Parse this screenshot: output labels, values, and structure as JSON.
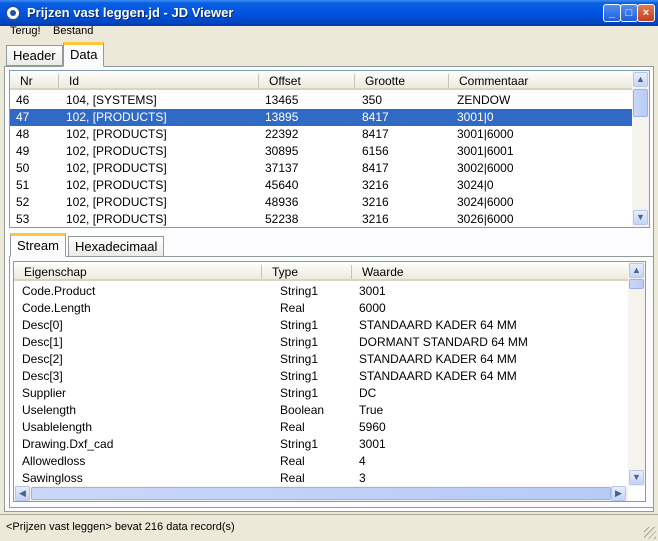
{
  "window": {
    "title": "Prijzen vast leggen.jd - JD Viewer"
  },
  "menu": {
    "back": "Terug!",
    "file": "Bestand"
  },
  "top_tabs": [
    {
      "label": "Header"
    },
    {
      "label": "Data"
    }
  ],
  "records": {
    "columns": [
      "Nr",
      "Id",
      "Offset",
      "Grootte",
      "Commentaar"
    ],
    "rows": [
      {
        "nr": "46",
        "id": "104, [SYSTEMS]",
        "offset": "13465",
        "size": "350",
        "comment": "ZENDOW"
      },
      {
        "nr": "47",
        "id": "102, [PRODUCTS]",
        "offset": "13895",
        "size": "8417",
        "comment": "3001|0"
      },
      {
        "nr": "48",
        "id": "102, [PRODUCTS]",
        "offset": "22392",
        "size": "8417",
        "comment": "3001|6000"
      },
      {
        "nr": "49",
        "id": "102, [PRODUCTS]",
        "offset": "30895",
        "size": "6156",
        "comment": "3001|6001"
      },
      {
        "nr": "50",
        "id": "102, [PRODUCTS]",
        "offset": "37137",
        "size": "8417",
        "comment": "3002|6000"
      },
      {
        "nr": "51",
        "id": "102, [PRODUCTS]",
        "offset": "45640",
        "size": "3216",
        "comment": "3024|0"
      },
      {
        "nr": "52",
        "id": "102, [PRODUCTS]",
        "offset": "48936",
        "size": "3216",
        "comment": "3024|6000"
      },
      {
        "nr": "53",
        "id": "102, [PRODUCTS]",
        "offset": "52238",
        "size": "3216",
        "comment": "3026|6000"
      }
    ],
    "selected_nr": "47"
  },
  "bottom_tabs": [
    {
      "label": "Stream"
    },
    {
      "label": "Hexadecimaal"
    }
  ],
  "properties": {
    "columns": [
      "Eigenschap",
      "Type",
      "Waarde"
    ],
    "rows": [
      {
        "name": "Code.Product",
        "type": "String1",
        "value": "3001"
      },
      {
        "name": "Code.Length",
        "type": "Real",
        "value": "6000"
      },
      {
        "name": "Desc[0]",
        "type": "String1",
        "value": "STANDAARD KADER 64 MM"
      },
      {
        "name": "Desc[1]",
        "type": "String1",
        "value": "DORMANT STANDARD 64 MM"
      },
      {
        "name": "Desc[2]",
        "type": "String1",
        "value": "STANDAARD KADER 64 MM"
      },
      {
        "name": "Desc[3]",
        "type": "String1",
        "value": "STANDAARD KADER 64 MM"
      },
      {
        "name": "Supplier",
        "type": "String1",
        "value": "DC"
      },
      {
        "name": "Uselength",
        "type": "Boolean",
        "value": "True"
      },
      {
        "name": "Usablelength",
        "type": "Real",
        "value": "5960"
      },
      {
        "name": "Drawing.Dxf_cad",
        "type": "String1",
        "value": "3001"
      },
      {
        "name": "Allowedloss",
        "type": "Real",
        "value": "4"
      },
      {
        "name": "Sawingloss",
        "type": "Real",
        "value": "3"
      }
    ]
  },
  "status": {
    "text": "<Prijzen vast leggen> bevat 216 data record(s)"
  }
}
